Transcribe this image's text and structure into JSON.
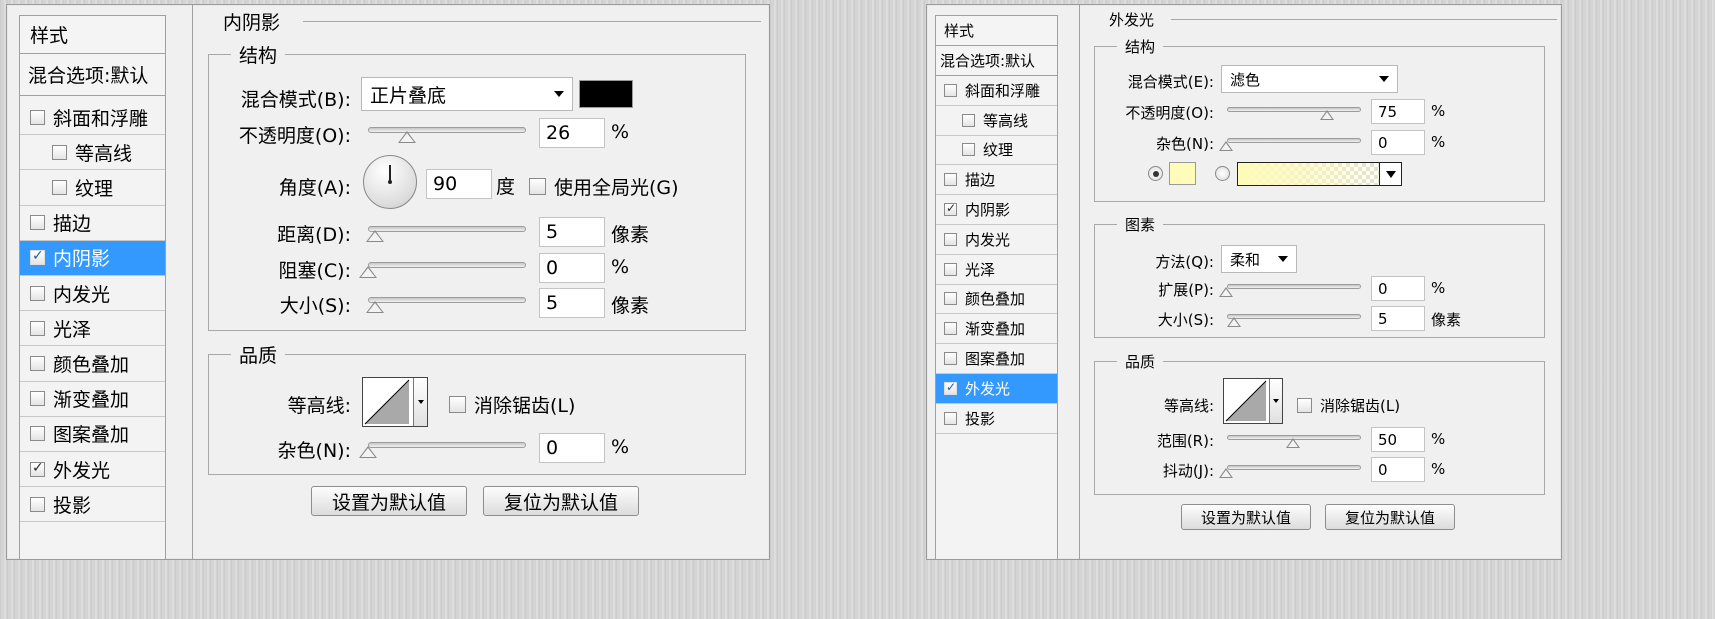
{
  "left": {
    "sidebar": {
      "header": "样式",
      "blend_default": "混合选项:默认",
      "items": [
        {
          "label": "斜面和浮雕",
          "checked": false,
          "selected": false,
          "indent": false
        },
        {
          "label": "等高线",
          "checked": false,
          "selected": false,
          "indent": true
        },
        {
          "label": "纹理",
          "checked": false,
          "selected": false,
          "indent": true
        },
        {
          "label": "描边",
          "checked": false,
          "selected": false,
          "indent": false
        },
        {
          "label": "内阴影",
          "checked": true,
          "selected": true,
          "indent": false
        },
        {
          "label": "内发光",
          "checked": false,
          "selected": false,
          "indent": false
        },
        {
          "label": "光泽",
          "checked": false,
          "selected": false,
          "indent": false
        },
        {
          "label": "颜色叠加",
          "checked": false,
          "selected": false,
          "indent": false
        },
        {
          "label": "渐变叠加",
          "checked": false,
          "selected": false,
          "indent": false
        },
        {
          "label": "图案叠加",
          "checked": false,
          "selected": false,
          "indent": false
        },
        {
          "label": "外发光",
          "checked": true,
          "selected": false,
          "indent": false
        },
        {
          "label": "投影",
          "checked": false,
          "selected": false,
          "indent": false
        }
      ]
    },
    "section_title": "内阴影",
    "structure": {
      "legend": "结构",
      "blend_mode_label": "混合模式(B):",
      "blend_mode_value": "正片叠底",
      "blend_color": "#000000",
      "opacity_label": "不透明度(O):",
      "opacity_value": "26",
      "opacity_unit": "%",
      "angle_label": "角度(A):",
      "angle_value": "90",
      "angle_unit": "度",
      "global_light_label": "使用全局光(G)",
      "distance_label": "距离(D):",
      "distance_value": "5",
      "distance_unit": "像素",
      "choke_label": "阻塞(C):",
      "choke_value": "0",
      "choke_unit": "%",
      "size_label": "大小(S):",
      "size_value": "5",
      "size_unit": "像素"
    },
    "quality": {
      "legend": "品质",
      "contour_label": "等高线:",
      "antialias_label": "消除锯齿(L)",
      "noise_label": "杂色(N):",
      "noise_value": "0",
      "noise_unit": "%"
    },
    "buttons": {
      "make_default": "设置为默认值",
      "reset_default": "复位为默认值"
    }
  },
  "right": {
    "sidebar": {
      "header": "样式",
      "blend_default": "混合选项:默认",
      "items": [
        {
          "label": "斜面和浮雕",
          "checked": false,
          "selected": false,
          "indent": false
        },
        {
          "label": "等高线",
          "checked": false,
          "selected": false,
          "indent": true
        },
        {
          "label": "纹理",
          "checked": false,
          "selected": false,
          "indent": true
        },
        {
          "label": "描边",
          "checked": false,
          "selected": false,
          "indent": false
        },
        {
          "label": "内阴影",
          "checked": true,
          "selected": false,
          "indent": false
        },
        {
          "label": "内发光",
          "checked": false,
          "selected": false,
          "indent": false
        },
        {
          "label": "光泽",
          "checked": false,
          "selected": false,
          "indent": false
        },
        {
          "label": "颜色叠加",
          "checked": false,
          "selected": false,
          "indent": false
        },
        {
          "label": "渐变叠加",
          "checked": false,
          "selected": false,
          "indent": false
        },
        {
          "label": "图案叠加",
          "checked": false,
          "selected": false,
          "indent": false
        },
        {
          "label": "外发光",
          "checked": true,
          "selected": true,
          "indent": false
        },
        {
          "label": "投影",
          "checked": false,
          "selected": false,
          "indent": false
        }
      ]
    },
    "section_title": "外发光",
    "structure": {
      "legend": "结构",
      "blend_mode_label": "混合模式(E):",
      "blend_mode_value": "滤色",
      "opacity_label": "不透明度(O):",
      "opacity_value": "75",
      "opacity_unit": "%",
      "noise_label": "杂色(N):",
      "noise_value": "0",
      "noise_unit": "%",
      "glow_color": "#fffbb8"
    },
    "elements": {
      "legend": "图素",
      "technique_label": "方法(Q):",
      "technique_value": "柔和",
      "spread_label": "扩展(P):",
      "spread_value": "0",
      "spread_unit": "%",
      "size_label": "大小(S):",
      "size_value": "5",
      "size_unit": "像素"
    },
    "quality": {
      "legend": "品质",
      "contour_label": "等高线:",
      "antialias_label": "消除锯齿(L)",
      "range_label": "范围(R):",
      "range_value": "50",
      "range_unit": "%",
      "jitter_label": "抖动(J):",
      "jitter_value": "0",
      "jitter_unit": "%"
    },
    "buttons": {
      "make_default": "设置为默认值",
      "reset_default": "复位为默认值"
    }
  }
}
